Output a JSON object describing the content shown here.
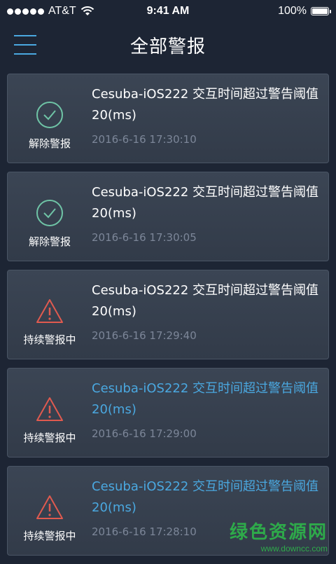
{
  "status_bar": {
    "carrier": "AT&T",
    "time": "9:41 AM",
    "battery": "100%"
  },
  "nav": {
    "title": "全部警报"
  },
  "alerts": [
    {
      "status": "resolved",
      "status_label": "解除警报",
      "message": "Cesuba-iOS222 交互时间超过警告阈值20(ms)",
      "time": "2016-6-16 17:30:10",
      "highlight": false
    },
    {
      "status": "resolved",
      "status_label": "解除警报",
      "message": "Cesuba-iOS222 交互时间超过警告阈值20(ms)",
      "time": "2016-6-16 17:30:05",
      "highlight": false
    },
    {
      "status": "ongoing",
      "status_label": "持续警报中",
      "message": "Cesuba-iOS222 交互时间超过警告阈值20(ms)",
      "time": "2016-6-16 17:29:40",
      "highlight": false
    },
    {
      "status": "ongoing",
      "status_label": "持续警报中",
      "message": "Cesuba-iOS222 交互时间超过警告阈值20(ms)",
      "time": "2016-6-16 17:29:00",
      "highlight": true
    },
    {
      "status": "ongoing",
      "status_label": "持续警报中",
      "message": "Cesuba-iOS222 交互时间超过警告阈值20(ms)",
      "time": "2016-6-16 17:28:10",
      "highlight": true
    }
  ],
  "watermark": {
    "main": "绿色资源网",
    "sub": "www.downcc.com"
  },
  "colors": {
    "background": "#1d2534",
    "accent": "#4aa8e0",
    "resolved_icon": "#6fc4a6",
    "alert_icon": "#e05a4f",
    "time_text": "#7c8698"
  },
  "icons": {
    "resolved": "check-circle-icon",
    "ongoing": "warning-triangle-icon",
    "menu": "menu-icon"
  }
}
